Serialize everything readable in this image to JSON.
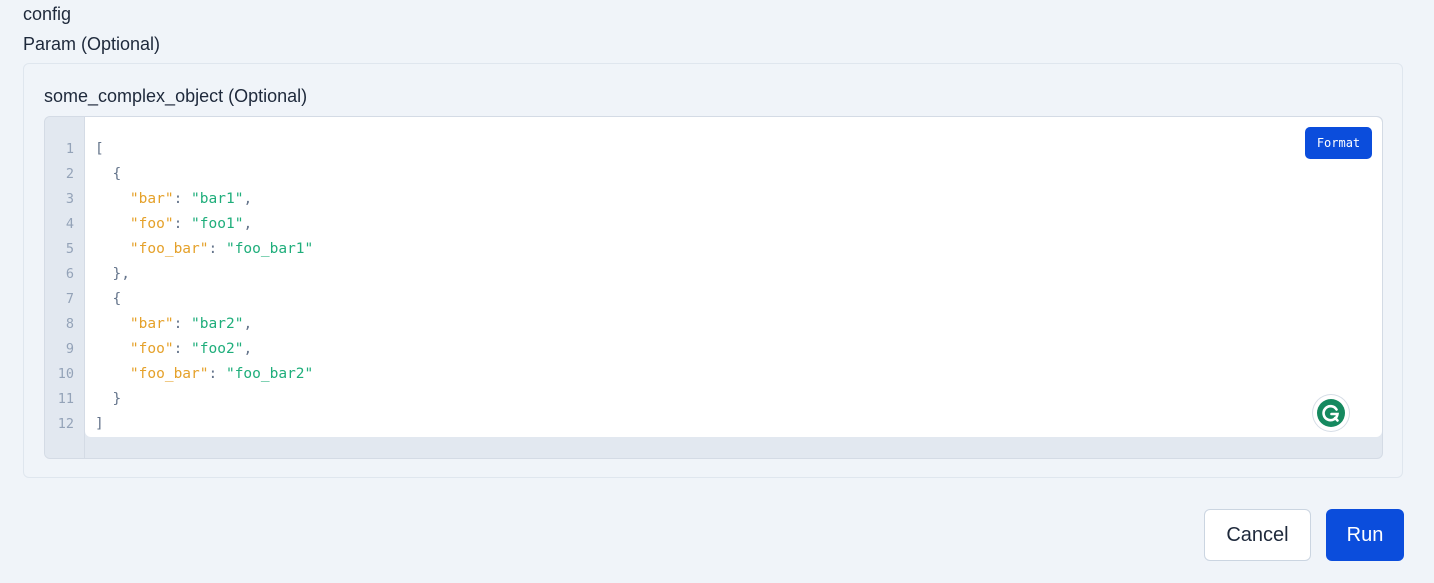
{
  "section_title": "config",
  "param_label": "Param (Optional)",
  "field": {
    "label": "some_complex_object (Optional)",
    "format_label": "Format",
    "line_numbers": [
      "1",
      "2",
      "3",
      "4",
      "5",
      "6",
      "7",
      "8",
      "9",
      "10",
      "11",
      "12"
    ],
    "lines": [
      [
        {
          "t": "[",
          "c": "p"
        }
      ],
      [
        {
          "t": "  {",
          "c": "p"
        }
      ],
      [
        {
          "t": "    ",
          "c": "p"
        },
        {
          "t": "\"bar\"",
          "c": "k"
        },
        {
          "t": ": ",
          "c": "p"
        },
        {
          "t": "\"bar1\"",
          "c": "s"
        },
        {
          "t": ",",
          "c": "p"
        }
      ],
      [
        {
          "t": "    ",
          "c": "p"
        },
        {
          "t": "\"foo\"",
          "c": "k"
        },
        {
          "t": ": ",
          "c": "p"
        },
        {
          "t": "\"foo1\"",
          "c": "s"
        },
        {
          "t": ",",
          "c": "p"
        }
      ],
      [
        {
          "t": "    ",
          "c": "p"
        },
        {
          "t": "\"foo_bar\"",
          "c": "k"
        },
        {
          "t": ": ",
          "c": "p"
        },
        {
          "t": "\"foo_bar1\"",
          "c": "s"
        }
      ],
      [
        {
          "t": "  },",
          "c": "p"
        }
      ],
      [
        {
          "t": "  {",
          "c": "p"
        }
      ],
      [
        {
          "t": "    ",
          "c": "p"
        },
        {
          "t": "\"bar\"",
          "c": "k"
        },
        {
          "t": ": ",
          "c": "p"
        },
        {
          "t": "\"bar2\"",
          "c": "s"
        },
        {
          "t": ",",
          "c": "p"
        }
      ],
      [
        {
          "t": "    ",
          "c": "p"
        },
        {
          "t": "\"foo\"",
          "c": "k"
        },
        {
          "t": ": ",
          "c": "p"
        },
        {
          "t": "\"foo2\"",
          "c": "s"
        },
        {
          "t": ",",
          "c": "p"
        }
      ],
      [
        {
          "t": "    ",
          "c": "p"
        },
        {
          "t": "\"foo_bar\"",
          "c": "k"
        },
        {
          "t": ": ",
          "c": "p"
        },
        {
          "t": "\"foo_bar2\"",
          "c": "s"
        }
      ],
      [
        {
          "t": "  }",
          "c": "p"
        }
      ],
      [
        {
          "t": "]",
          "c": "p"
        }
      ]
    ]
  },
  "actions": {
    "cancel_label": "Cancel",
    "run_label": "Run"
  },
  "colors": {
    "primary": "#0b4ddc",
    "json_key": "#e5a12a",
    "json_string": "#1fae7b",
    "grammarly": "#15895f"
  },
  "icons": {
    "grammarly": "grammarly-icon"
  }
}
